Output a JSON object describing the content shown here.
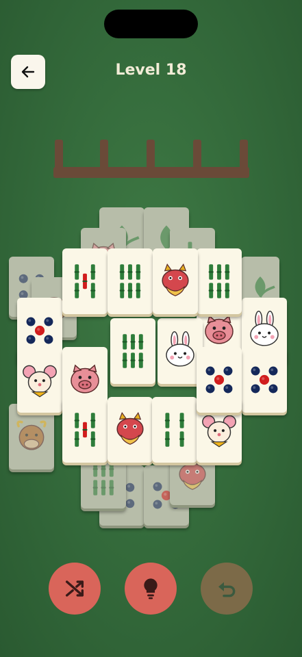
{
  "header": {
    "title": "Level 18",
    "back_icon": "arrow-left-icon"
  },
  "tray": {
    "slots": 4,
    "filled": 0
  },
  "tiles": [
    {
      "kind": "bamboo-leaf",
      "layer": "bottom"
    },
    {
      "kind": "bamboo-leaf",
      "layer": "bottom"
    },
    {
      "kind": "pig",
      "layer": "bottom"
    },
    {
      "kind": "bamboo-stick",
      "layer": "bottom"
    },
    {
      "kind": "circles-4",
      "layer": "bottom"
    },
    {
      "kind": "tiger",
      "layer": "bottom"
    },
    {
      "kind": "bamboo-leaf",
      "layer": "bottom"
    },
    {
      "kind": "ox",
      "layer": "bottom"
    },
    {
      "kind": "circles-4",
      "layer": "bottom"
    },
    {
      "kind": "circles-5",
      "layer": "bottom"
    },
    {
      "kind": "bamboo-6",
      "layer": "bottom"
    },
    {
      "kind": "dragon",
      "layer": "bottom"
    },
    {
      "kind": "circles-5",
      "layer": "top"
    },
    {
      "kind": "bamboo-5",
      "layer": "top"
    },
    {
      "kind": "bamboo-6",
      "layer": "top"
    },
    {
      "kind": "pig",
      "layer": "top"
    },
    {
      "kind": "rabbit",
      "layer": "top"
    },
    {
      "kind": "bamboo-6",
      "layer": "top"
    },
    {
      "kind": "rabbit",
      "layer": "top"
    },
    {
      "kind": "mouse",
      "layer": "top"
    },
    {
      "kind": "pig",
      "layer": "top"
    },
    {
      "kind": "circles-5",
      "layer": "top"
    },
    {
      "kind": "bamboo-5",
      "layer": "top"
    },
    {
      "kind": "dragon",
      "layer": "top"
    },
    {
      "kind": "bamboo-4",
      "layer": "top"
    },
    {
      "kind": "mouse",
      "layer": "top"
    },
    {
      "kind": "circles-5",
      "layer": "top"
    },
    {
      "kind": "dragon",
      "layer": "top"
    }
  ],
  "controls": [
    {
      "name": "shuffle-button",
      "icon": "shuffle-icon",
      "enabled": true
    },
    {
      "name": "hint-button",
      "icon": "lightbulb-icon",
      "enabled": true
    },
    {
      "name": "undo-button",
      "icon": "undo-icon",
      "enabled": false
    }
  ],
  "colors": {
    "felt": "#356c3c",
    "tile_face": "#fbf7e7",
    "tile_dim": "#b7bda9",
    "button_active": "#d9655a",
    "button_disabled": "#7c6a48",
    "bamboo_green": "#2e7d3a",
    "dot_navy": "#14285a",
    "dot_red": "#d11d1d",
    "tray_brown": "#6a4a38"
  }
}
